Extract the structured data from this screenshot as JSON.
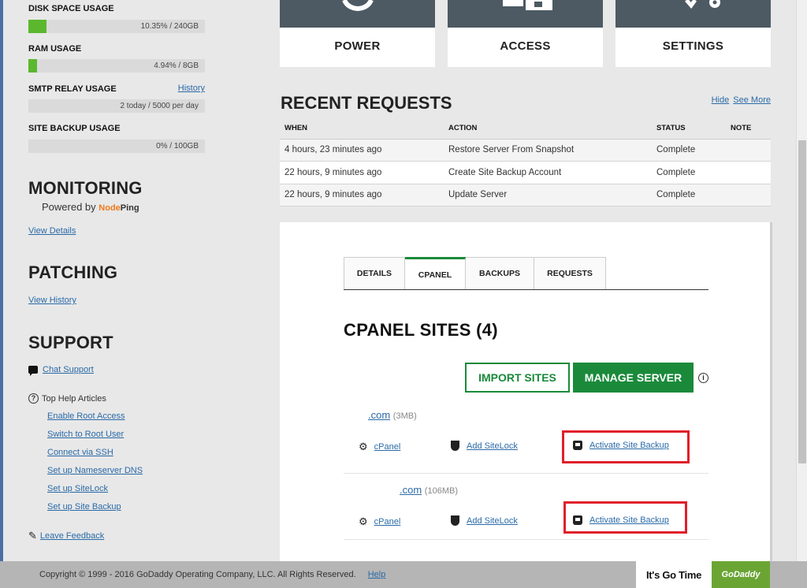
{
  "usage": {
    "disk": {
      "label": "DISK SPACE USAGE",
      "value": "10.35% / 240GB",
      "percent": 10.35
    },
    "ram": {
      "label": "RAM USAGE",
      "value": "4.94% / 8GB",
      "percent": 4.94
    },
    "smtp": {
      "label": "SMTP RELAY USAGE",
      "history_label": "History",
      "value": "2 today / 5000 per day",
      "percent": 0
    },
    "backup": {
      "label": "SITE BACKUP USAGE",
      "value": "0% / 100GB",
      "percent": 0
    }
  },
  "monitoring": {
    "title": "MONITORING",
    "powered_by": "Powered by",
    "brand_part1": "Node",
    "brand_part2": "Ping",
    "link": "View Details"
  },
  "patching": {
    "title": "PATCHING",
    "link": "View History"
  },
  "support": {
    "title": "SUPPORT",
    "chat": "Chat Support",
    "help_heading": "Top Help Articles",
    "articles": [
      "Enable Root Access",
      "Switch to Root User",
      "Connect via SSH",
      "Set up Nameserver DNS",
      "Set up SiteLock",
      "Set up Site Backup"
    ],
    "feedback": "Leave Feedback"
  },
  "cards": [
    {
      "label": "POWER",
      "icon": "power-icon"
    },
    {
      "label": "ACCESS",
      "icon": "access-icon"
    },
    {
      "label": "SETTINGS",
      "icon": "settings-icon"
    }
  ],
  "recent_requests": {
    "title": "RECENT REQUESTS",
    "hide_label": "Hide",
    "see_more_label": "See More",
    "columns": [
      "WHEN",
      "ACTION",
      "STATUS",
      "NOTE"
    ],
    "rows": [
      {
        "when": "4 hours, 23 minutes ago",
        "action": "Restore Server From Snapshot",
        "status": "Complete",
        "note": ""
      },
      {
        "when": "22 hours, 9 minutes ago",
        "action": "Create Site Backup Account",
        "status": "Complete",
        "note": ""
      },
      {
        "when": "22 hours, 9 minutes ago",
        "action": "Update Server",
        "status": "Complete",
        "note": ""
      }
    ]
  },
  "tabs": [
    "DETAILS",
    "CPANEL",
    "BACKUPS",
    "REQUESTS"
  ],
  "active_tab": "CPANEL",
  "cpanel": {
    "title": "CPANEL SITES (4)",
    "import_label": "IMPORT SITES",
    "manage_label": "MANAGE SERVER",
    "sites": [
      {
        "domain": ".com",
        "size": "(3MB)",
        "cpanel": "cPanel",
        "sitelock": "Add SiteLock",
        "backup": "Activate Site Backup"
      },
      {
        "domain": ".com",
        "size": "(106MB)",
        "cpanel": "cPanel",
        "sitelock": "Add SiteLock",
        "backup": "Activate Site Backup"
      }
    ]
  },
  "footer": {
    "copyright": "Copyright ©  1999 - 2016 GoDaddy Operating Company, LLC. All Rights Reserved.",
    "help": "Help",
    "tagline": "It's Go Time",
    "logo": "GoDaddy"
  },
  "colors": {
    "accent_green": "#1a8a3a",
    "bar_green": "#5bb82e",
    "highlight_red": "#e0202a",
    "card_dark": "#4d5a63"
  }
}
